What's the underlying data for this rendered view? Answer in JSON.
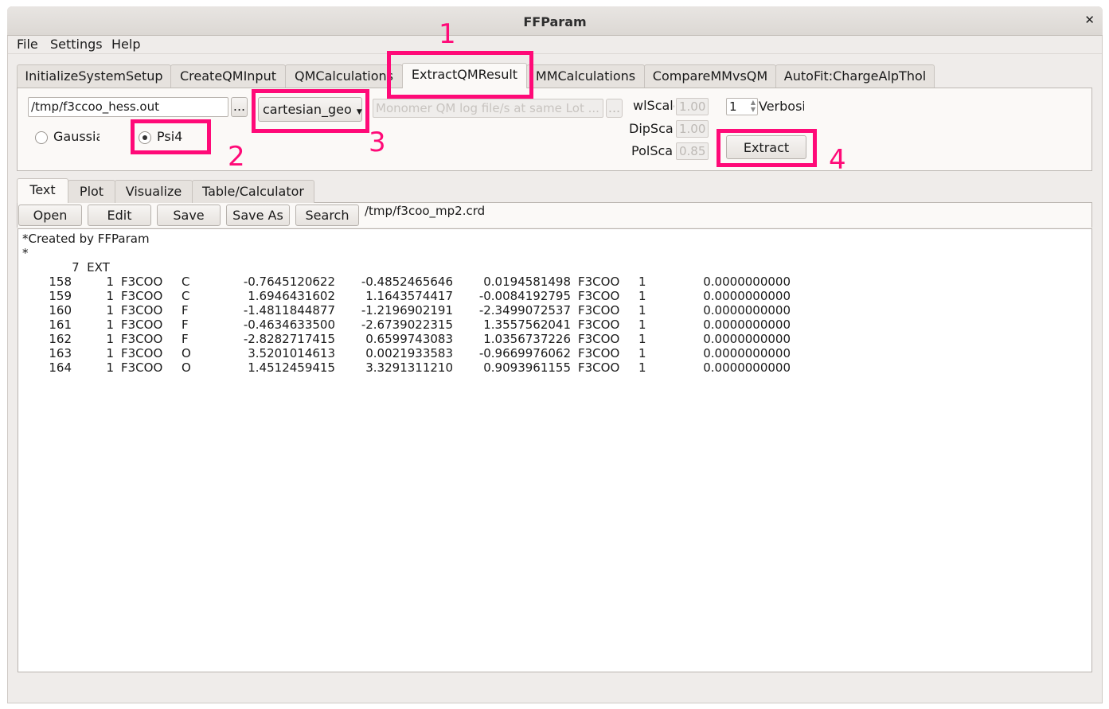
{
  "window": {
    "title": "FFParam",
    "close_icon": "close-icon"
  },
  "menu": [
    "File",
    "Settings",
    "Help"
  ],
  "main_tabs": [
    "InitializeSystemSetup",
    "CreateQMInput",
    "QMCalculations",
    "ExtractQMResult",
    "MMCalculations",
    "CompareMMvsQM",
    "AutoFit:ChargeAlpThol"
  ],
  "active_main_tab": "ExtractQMResult",
  "extract": {
    "file_path": "/tmp/f3ccoo_hess.out",
    "browse_label": "...",
    "radio_gaussian": "Gaussia",
    "radio_psi4": "Psi4",
    "selected_program": "Psi4",
    "geo_select": "cartesian_geo",
    "monomer_placeholder": "Monomer QM log file/s at same Lot ...",
    "monomer_browse": "...",
    "wlscale_label": "wlScale",
    "wlscale_value": "1.00",
    "dipscale_label": "DipScale",
    "dipscale_value": "1.00",
    "polscale_label": "PolScal",
    "polscale_value": "0.85",
    "verbosity_value": "1",
    "verbosity_label": "Verbosi",
    "extract_label": "Extract"
  },
  "annotations": [
    "1",
    "2",
    "3",
    "4"
  ],
  "annotation_color": "#ff0a78",
  "sub_tabs": [
    "Text",
    "Plot",
    "Visualize",
    "Table/Calculator"
  ],
  "active_sub_tab": "Text",
  "toolbar": {
    "open": "Open",
    "edit": "Edit",
    "save": "Save",
    "save_as": "Save As",
    "search": "Search",
    "current_file": "/tmp/f3coo_mp2.crd"
  },
  "editor": {
    "header": [
      "*Created by FFParam",
      "*",
      "    7  EXT"
    ],
    "rows": [
      [
        "158",
        "1",
        "F3COO",
        "C",
        "-0.7645120622",
        "-0.4852465646",
        "0.0194581498",
        "F3COO",
        "1",
        "0.0000000000"
      ],
      [
        "159",
        "1",
        "F3COO",
        "C",
        "1.6946431602",
        "1.1643574417",
        "-0.0084192795",
        "F3COO",
        "1",
        "0.0000000000"
      ],
      [
        "160",
        "1",
        "F3COO",
        "F",
        "-1.4811844877",
        "-1.2196902191",
        "-2.3499072537",
        "F3COO",
        "1",
        "0.0000000000"
      ],
      [
        "161",
        "1",
        "F3COO",
        "F",
        "-0.4634633500",
        "-2.6739022315",
        "1.3557562041",
        "F3COO",
        "1",
        "0.0000000000"
      ],
      [
        "162",
        "1",
        "F3COO",
        "F",
        "-2.8282717415",
        "0.6599743083",
        "1.0356737226",
        "F3COO",
        "1",
        "0.0000000000"
      ],
      [
        "163",
        "1",
        "F3COO",
        "O",
        "3.5201014613",
        "0.0021933583",
        "-0.9669976062",
        "F3COO",
        "1",
        "0.0000000000"
      ],
      [
        "164",
        "1",
        "F3COO",
        "O",
        "1.4512459415",
        "3.3291311210",
        "0.9093961155",
        "F3COO",
        "1",
        "0.0000000000"
      ]
    ]
  }
}
